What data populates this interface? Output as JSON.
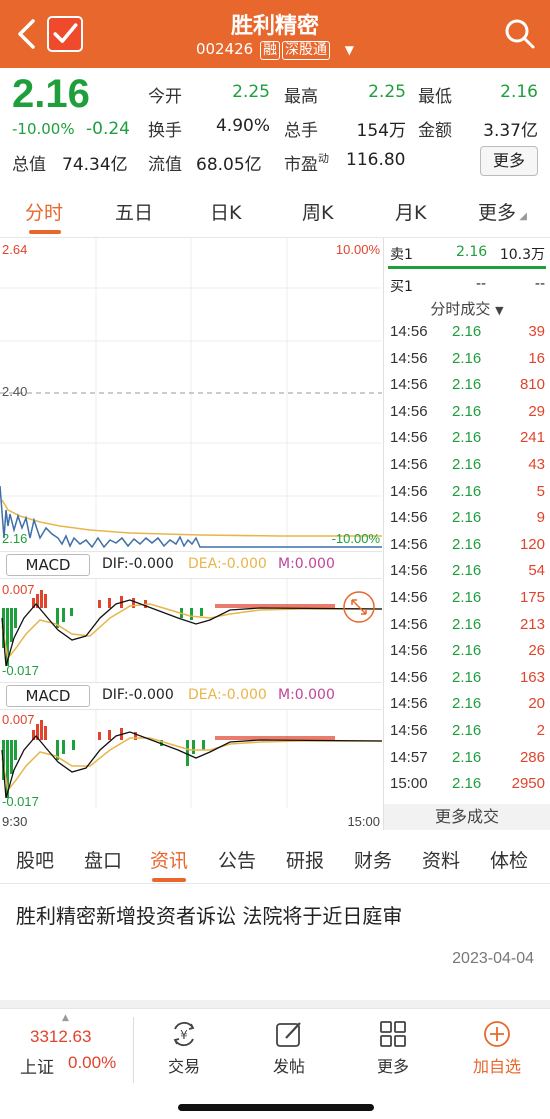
{
  "header": {
    "title": "胜利精密",
    "code": "002426",
    "tag_margin": "融",
    "tag_connect": "深股通"
  },
  "quote": {
    "price": "2.16",
    "change_pct": "-10.00%",
    "change": "-0.24",
    "fields": [
      {
        "label": "今开",
        "value": "2.25"
      },
      {
        "label": "最高",
        "value": "2.25"
      },
      {
        "label": "最低",
        "value": "2.16"
      },
      {
        "label": "换手",
        "value": "4.90%"
      },
      {
        "label": "总手",
        "value": "154万"
      },
      {
        "label": "金额",
        "value": "3.37亿"
      },
      {
        "label": "总值",
        "value": "74.34亿"
      },
      {
        "label": "流值",
        "value": "68.05亿"
      },
      {
        "label": "市盈",
        "value": "116.80",
        "sup": "动"
      }
    ],
    "more_label": "更多"
  },
  "tabs": [
    "分时",
    "五日",
    "日K",
    "周K",
    "月K",
    "更多"
  ],
  "chart": {
    "y_top": "2.64",
    "y_mid": "2.40",
    "y_bottom": "2.16",
    "pct_top": "10.00%",
    "pct_bottom": "-10.00%",
    "time_start": "9:30",
    "time_end": "15:00",
    "macd_panels": [
      {
        "label": "MACD",
        "dif": "DIF:-0.000",
        "dea": "DEA:-0.000",
        "m": "M:0.000",
        "top_tick": "0.007",
        "bottom_tick": "-0.017"
      },
      {
        "label": "MACD",
        "dif": "DIF:-0.000",
        "dea": "DEA:-0.000",
        "m": "M:0.000",
        "top_tick": "0.007",
        "bottom_tick": "-0.017"
      }
    ],
    "colors": {
      "up": "#e0442d",
      "down": "#1f9f3c",
      "price_line": "#3e6fa8",
      "avg_line": "#e8b54a"
    }
  },
  "orderbook": {
    "sell1": {
      "label": "卖1",
      "price": "2.16",
      "vol": "10.3万"
    },
    "buy1": {
      "label": "买1",
      "price": "--",
      "vol": "--"
    }
  },
  "trades_header": "分时成交",
  "trades": [
    {
      "time": "14:56",
      "price": "2.16",
      "vol": "39"
    },
    {
      "time": "14:56",
      "price": "2.16",
      "vol": "16"
    },
    {
      "time": "14:56",
      "price": "2.16",
      "vol": "810"
    },
    {
      "time": "14:56",
      "price": "2.16",
      "vol": "29"
    },
    {
      "time": "14:56",
      "price": "2.16",
      "vol": "241"
    },
    {
      "time": "14:56",
      "price": "2.16",
      "vol": "43"
    },
    {
      "time": "14:56",
      "price": "2.16",
      "vol": "5"
    },
    {
      "time": "14:56",
      "price": "2.16",
      "vol": "9"
    },
    {
      "time": "14:56",
      "price": "2.16",
      "vol": "120"
    },
    {
      "time": "14:56",
      "price": "2.16",
      "vol": "54"
    },
    {
      "time": "14:56",
      "price": "2.16",
      "vol": "175"
    },
    {
      "time": "14:56",
      "price": "2.16",
      "vol": "213"
    },
    {
      "time": "14:56",
      "price": "2.16",
      "vol": "26"
    },
    {
      "time": "14:56",
      "price": "2.16",
      "vol": "163"
    },
    {
      "time": "14:56",
      "price": "2.16",
      "vol": "20"
    },
    {
      "time": "14:56",
      "price": "2.16",
      "vol": "2"
    },
    {
      "time": "14:57",
      "price": "2.16",
      "vol": "286"
    },
    {
      "time": "15:00",
      "price": "2.16",
      "vol": "2950"
    }
  ],
  "more_trades": "更多成交",
  "news_tabs": [
    "股吧",
    "盘口",
    "资讯",
    "公告",
    "研报",
    "财务",
    "资料",
    "体检"
  ],
  "news": {
    "title": "胜利精密新增投资者诉讼 法院将于近日庭审",
    "date": "2023-04-04"
  },
  "footer": {
    "index_value": "3312.63",
    "index_name": "上证",
    "index_pct": "0.00%",
    "buttons": [
      {
        "label": "交易",
        "icon": "yuan-exchange-icon"
      },
      {
        "label": "发帖",
        "icon": "edit-icon"
      },
      {
        "label": "更多",
        "icon": "grid-icon"
      },
      {
        "label": "加自选",
        "icon": "plus-circle-icon"
      }
    ]
  }
}
